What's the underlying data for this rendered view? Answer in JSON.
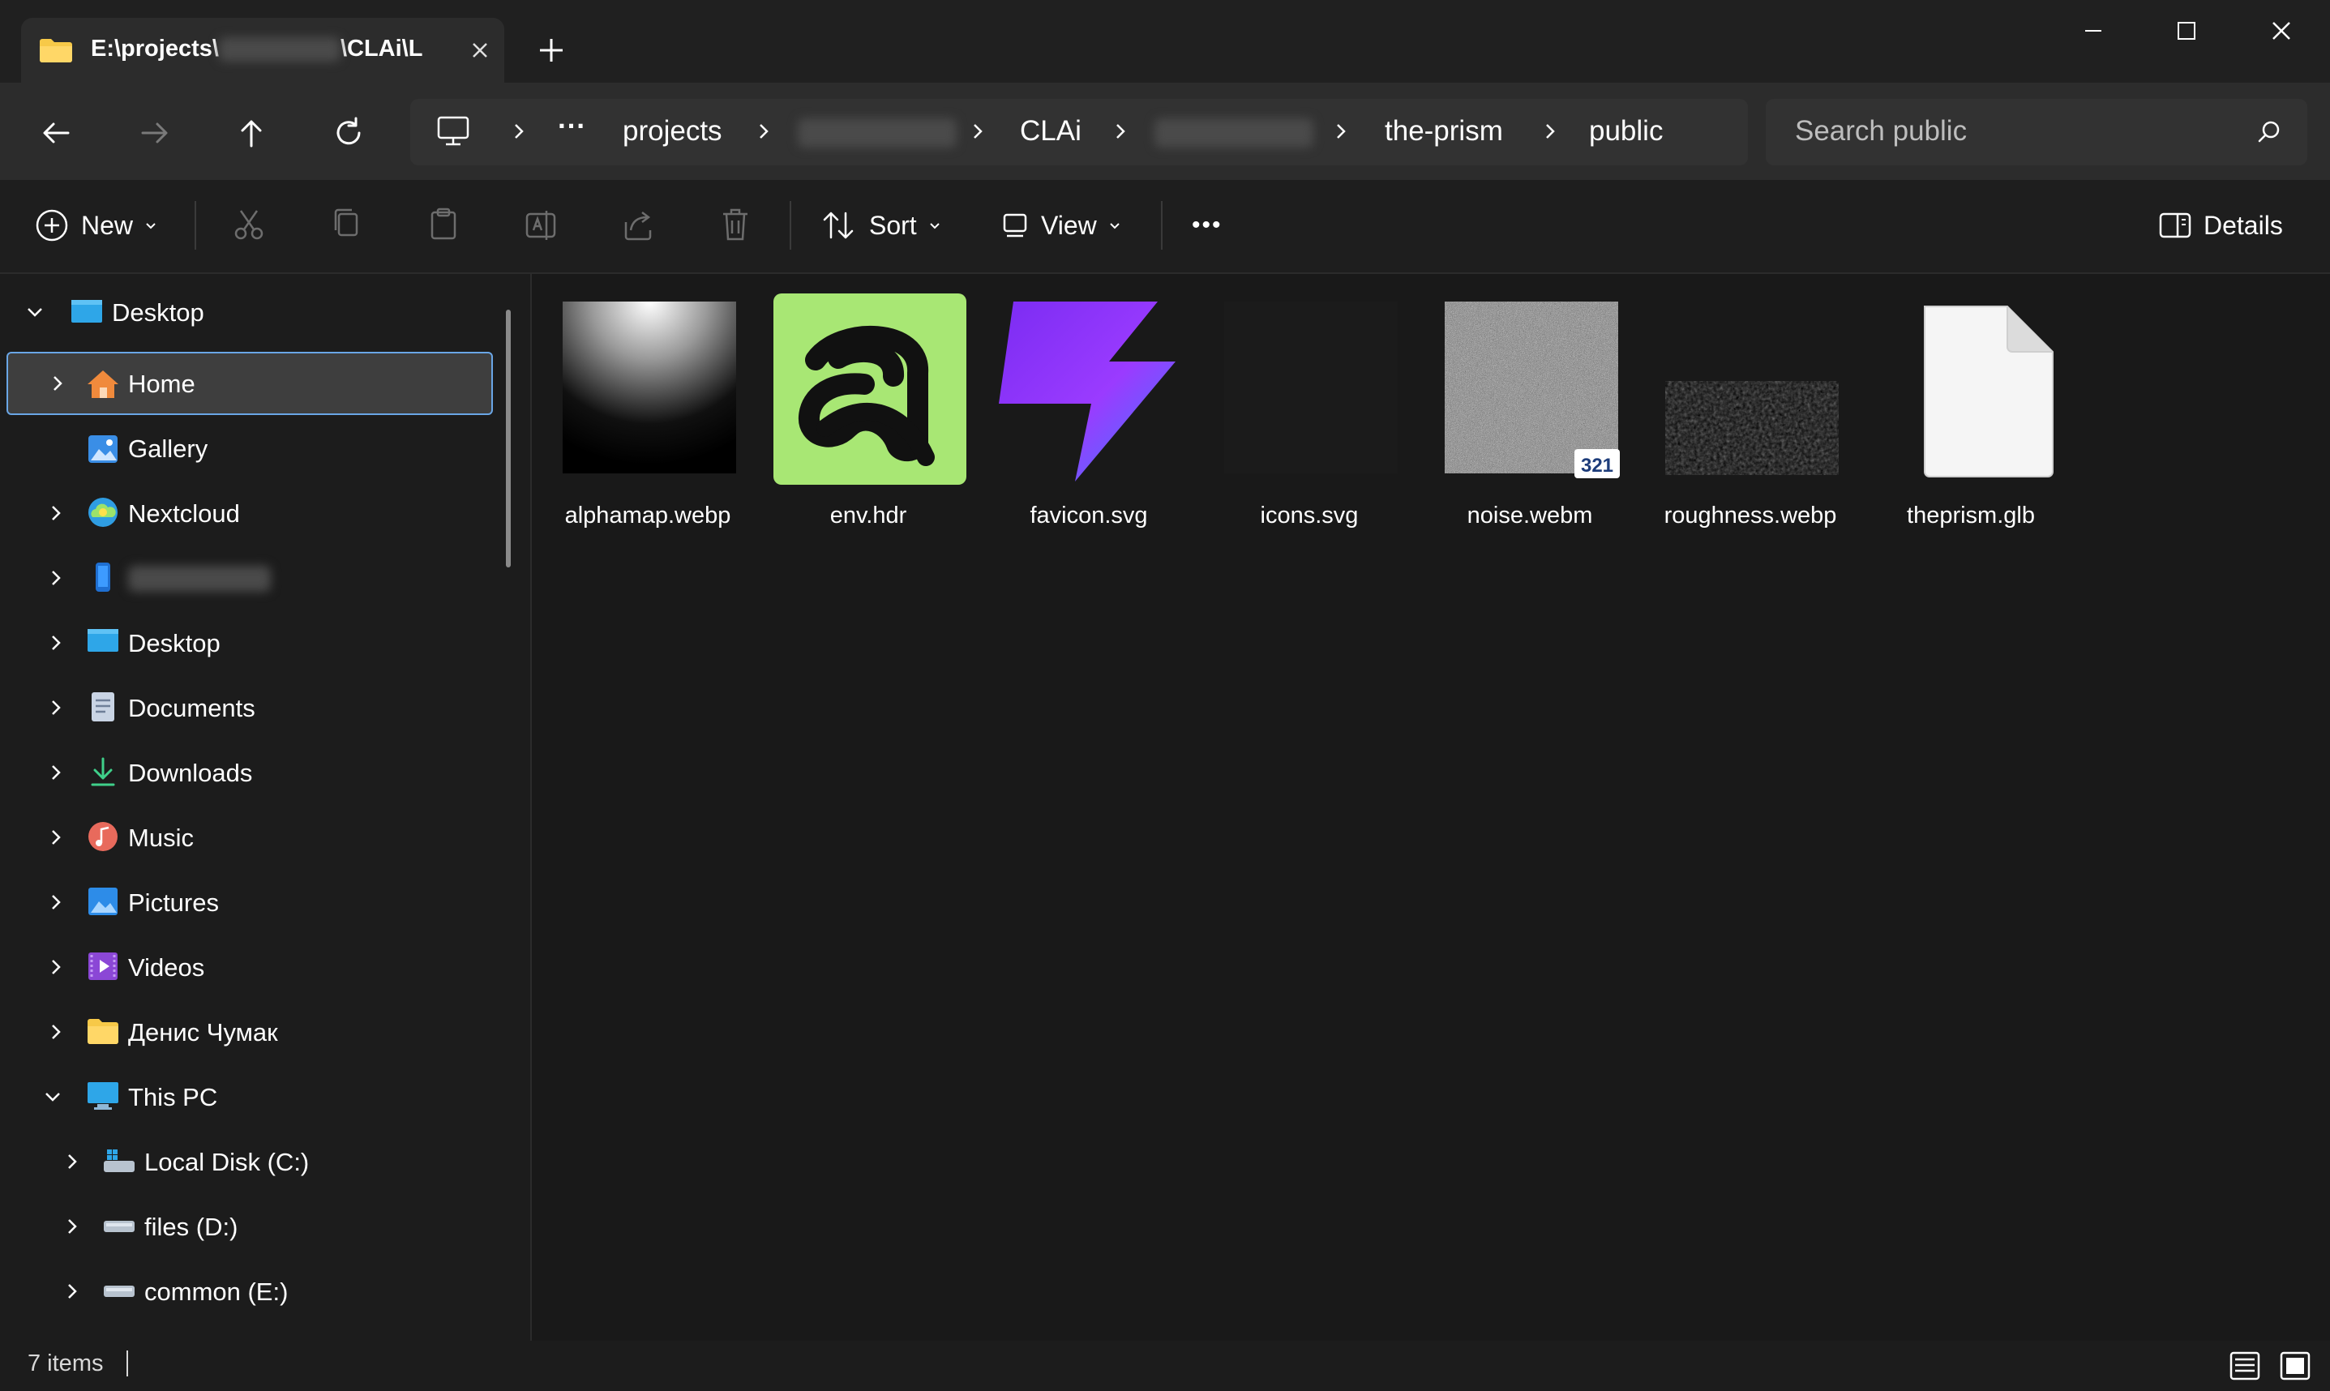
{
  "window": {
    "tab_title_start": "E:\\projects\\",
    "tab_title_end": "\\CLAi\\L"
  },
  "navigation": {
    "breadcrumb": [
      "projects",
      "CLAi",
      "the-prism",
      "public"
    ],
    "ellipsis": "···",
    "search_placeholder": "Search public"
  },
  "commands": {
    "new": "New",
    "sort": "Sort",
    "view": "View",
    "more": "•••",
    "details": "Details"
  },
  "sidebar": {
    "items": [
      {
        "label": "Desktop",
        "icon": "desktop-icon",
        "expanded": true
      },
      {
        "label": "Home",
        "icon": "home-icon",
        "selected": true
      },
      {
        "label": "Gallery",
        "icon": "gallery-icon"
      },
      {
        "label": "Nextcloud",
        "icon": "nextcloud-icon"
      },
      {
        "label": "",
        "icon": "phone-icon"
      },
      {
        "label": "Desktop",
        "icon": "desktop-icon"
      },
      {
        "label": "Documents",
        "icon": "documents-icon"
      },
      {
        "label": "Downloads",
        "icon": "downloads-icon"
      },
      {
        "label": "Music",
        "icon": "music-icon"
      },
      {
        "label": "Pictures",
        "icon": "pictures-icon"
      },
      {
        "label": "Videos",
        "icon": "videos-icon"
      },
      {
        "label": "Денис Чумак",
        "icon": "folder-icon"
      },
      {
        "label": "This PC",
        "icon": "this-pc-icon",
        "expanded": true
      },
      {
        "label": "Local Disk (C:)",
        "icon": "drive-icon"
      },
      {
        "label": "files (D:)",
        "icon": "drive-icon"
      },
      {
        "label": "common (E:)",
        "icon": "drive-icon"
      }
    ]
  },
  "files": [
    {
      "name": "alphamap.webp",
      "icon": "alphamap-thumbnail"
    },
    {
      "name": "env.hdr",
      "icon": "env-hdr-thumbnail"
    },
    {
      "name": "favicon.svg",
      "icon": "favicon-thumbnail"
    },
    {
      "name": "icons.svg",
      "icon": "icons-svg-thumbnail"
    },
    {
      "name": "noise.webm",
      "icon": "noise-video-thumbnail",
      "badge": "321"
    },
    {
      "name": "roughness.webp",
      "icon": "roughness-thumbnail"
    },
    {
      "name": "theprism.glb",
      "icon": "generic-file-icon"
    }
  ],
  "status": {
    "item_count": "7 items"
  },
  "colors": {
    "accent": "#6aa6e6",
    "envhdr_bg": "#a8e774",
    "favicon_purple": "#8a2be2"
  }
}
